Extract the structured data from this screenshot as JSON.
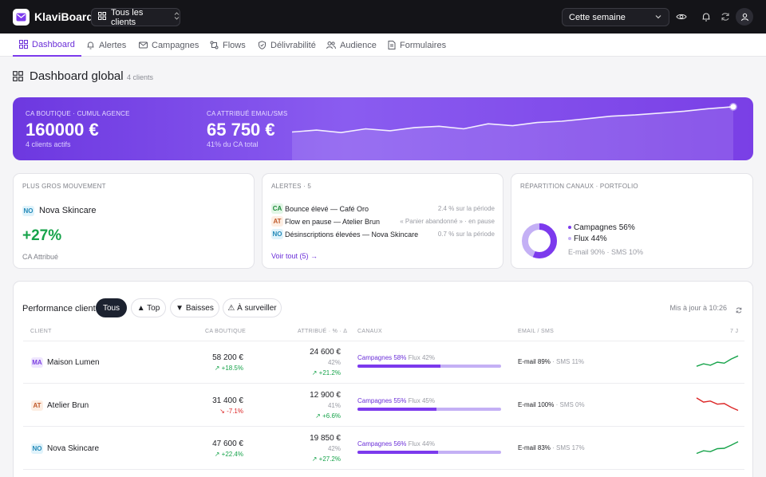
{
  "app": {
    "name": "KlaviBoard"
  },
  "header": {
    "client_select": "Tous les clients",
    "period_select": "Cette semaine"
  },
  "tabs": [
    {
      "label": "Dashboard",
      "active": true
    },
    {
      "label": "Alertes"
    },
    {
      "label": "Campagnes"
    },
    {
      "label": "Flows"
    },
    {
      "label": "Délivrabilité"
    },
    {
      "label": "Audience"
    },
    {
      "label": "Formulaires"
    }
  ],
  "page": {
    "title": "Dashboard global",
    "count": "4 clients"
  },
  "hero": {
    "boutique_label": "CA BOUTIQUE · CUMUL AGENCE",
    "boutique_value": "160000 €",
    "boutique_sub": "4 clients actifs",
    "attrib_label": "CA ATTRIBUÉ EMAIL/SMS",
    "attrib_value": "65 750 €",
    "attrib_sub": "41% du CA total",
    "trend": [
      0.55,
      0.52,
      0.56,
      0.5,
      0.53,
      0.48,
      0.46,
      0.5,
      0.42,
      0.45,
      0.4,
      0.38,
      0.34,
      0.3,
      0.28,
      0.25,
      0.22,
      0.18,
      0.15
    ]
  },
  "mover": {
    "label": "PLUS GROS MOUVEMENT",
    "client_code": "NO",
    "client_name": "Nova Skincare",
    "delta": "+27%",
    "metric": "CA Attribué"
  },
  "alerts": {
    "label": "ALERTES · 5",
    "items": [
      {
        "code": "CA",
        "text": "Bounce élevé — Café Oro",
        "meta": "2.4 % sur la période"
      },
      {
        "code": "AT",
        "text": "Flow en pause — Atelier Brun",
        "meta": "« Panier abandonné » · en pause"
      },
      {
        "code": "NO",
        "text": "Désinscriptions élevées — Nova Skincare",
        "meta": "0.7 % sur la période"
      }
    ],
    "see_all": "Voir tout (5) →"
  },
  "channels": {
    "label": "RÉPARTITION CANAUX · PORTFOLIO",
    "campaigns": "Campagnes 56%",
    "flows": "Flux 44%",
    "campaigns_share": 56,
    "sub": "E-mail 90% · SMS 10%"
  },
  "performance": {
    "title": "Performance client",
    "filters": [
      "Tous",
      "▲ Top",
      "▼ Baisses",
      "⚠ À surveiller"
    ],
    "updated": "Mis à jour à 10:26",
    "columns": {
      "client": "CLIENT",
      "ca": "CA BOUTIQUE",
      "attrib": "ATTRIBUÉ · % · Δ",
      "channels": "CANAUX",
      "mix": "EMAIL / SMS",
      "days": "7 J"
    },
    "rows": [
      {
        "code": "MA",
        "name": "Maison Lumen",
        "ca": "58 200 €",
        "ca_delta": "+18.5%",
        "ca_dir": "up",
        "attrib": "24 600 €",
        "attrib_pct": "42%",
        "attrib_delta": "+21.2%",
        "attrib_dir": "up",
        "campaigns": "Campagnes 58%",
        "flows": "Flux 42%",
        "campaigns_share": 58,
        "email": "E-mail 89%",
        "sms": "· SMS 11%",
        "spark": [
          0.3,
          0.42,
          0.35,
          0.5,
          0.45,
          0.65,
          0.8
        ],
        "spark_dir": "up"
      },
      {
        "code": "AT",
        "name": "Atelier Brun",
        "ca": "31 400 €",
        "ca_delta": "-7.1%",
        "ca_dir": "down",
        "attrib": "12 900 €",
        "attrib_pct": "41%",
        "attrib_delta": "+6.6%",
        "attrib_dir": "up",
        "campaigns": "Campagnes 55%",
        "flows": "Flux 45%",
        "campaigns_share": 55,
        "email": "E-mail 100%",
        "sms": "· SMS 0%",
        "spark": [
          0.85,
          0.65,
          0.7,
          0.55,
          0.58,
          0.4,
          0.25
        ],
        "spark_dir": "down"
      },
      {
        "code": "NO",
        "name": "Nova Skincare",
        "ca": "47 600 €",
        "ca_delta": "+22.4%",
        "ca_dir": "up",
        "attrib": "19 850 €",
        "attrib_pct": "42%",
        "attrib_delta": "+27.2%",
        "attrib_dir": "up",
        "campaigns": "Campagnes 56%",
        "flows": "Flux 44%",
        "campaigns_share": 56,
        "email": "E-mail 83%",
        "sms": "· SMS 17%",
        "spark": [
          0.25,
          0.38,
          0.34,
          0.48,
          0.5,
          0.65,
          0.82
        ],
        "spark_dir": "up"
      }
    ]
  },
  "colors": {
    "accent": "#7c3aed",
    "up": "#16a34a",
    "down": "#dc2626",
    "topbar": "#141418"
  }
}
